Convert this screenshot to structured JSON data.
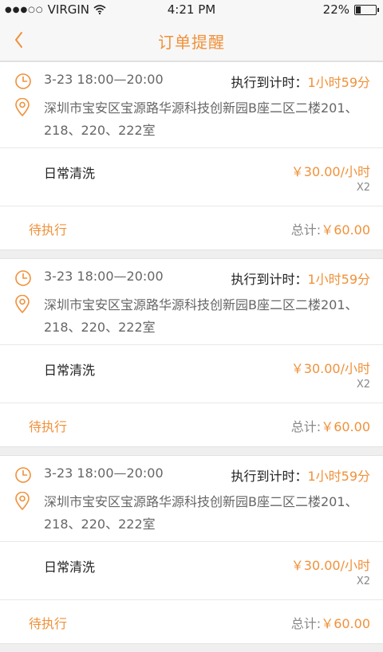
{
  "status_bar": {
    "signal_dots": "●●●○○",
    "carrier": "VIRGIN",
    "time": "4:21 PM",
    "battery_text": "22%",
    "battery_level": 0.22
  },
  "nav": {
    "title": "订单提醒",
    "back_icon": "chevron-left-icon"
  },
  "colors": {
    "accent": "#f0913a"
  },
  "orders": [
    {
      "time_range": "3-23 18:00—20:00",
      "countdown_label": "执行到计时：",
      "countdown_value": "1小时59分",
      "address": "深圳市宝安区宝源路华源科技创新园B座二区二楼201、218、220、222室",
      "service": "日常清洗",
      "price": "￥30.00/小时",
      "quantity": "X2",
      "status": "待执行",
      "total_label": "总计:",
      "total_value": "￥60.00"
    },
    {
      "time_range": "3-23 18:00—20:00",
      "countdown_label": "执行到计时：",
      "countdown_value": "1小时59分",
      "address": "深圳市宝安区宝源路华源科技创新园B座二区二楼201、218、220、222室",
      "service": "日常清洗",
      "price": "￥30.00/小时",
      "quantity": "X2",
      "status": "待执行",
      "total_label": "总计:",
      "total_value": "￥60.00"
    },
    {
      "time_range": "3-23 18:00—20:00",
      "countdown_label": "执行到计时：",
      "countdown_value": "1小时59分",
      "address": "深圳市宝安区宝源路华源科技创新园B座二区二楼201、218、220、222室",
      "service": "日常清洗",
      "price": "￥30.00/小时",
      "quantity": "X2",
      "status": "待执行",
      "total_label": "总计:",
      "total_value": "￥60.00"
    }
  ]
}
